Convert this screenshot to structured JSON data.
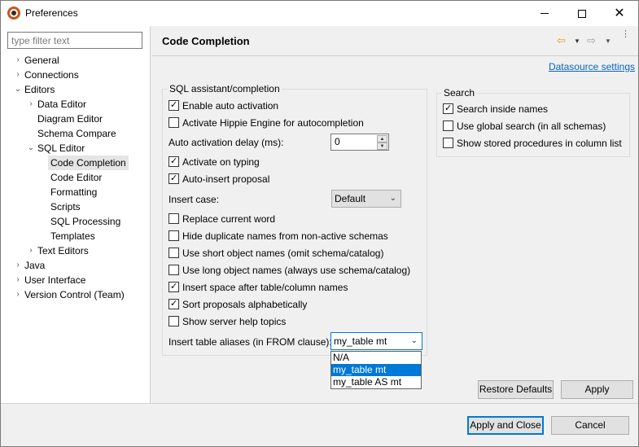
{
  "window": {
    "title": "Preferences",
    "minimize_glyph": "",
    "maximize_glyph": "",
    "close_glyph": "✕"
  },
  "filter": {
    "placeholder": "type filter text",
    "value": ""
  },
  "tree": {
    "chevron_collapsed": "›",
    "chevron_expanded": "⌄",
    "general": "General",
    "connections": "Connections",
    "editors": "Editors",
    "data_editor": "Data Editor",
    "diagram_editor": "Diagram Editor",
    "schema_compare": "Schema Compare",
    "sql_editor": "SQL Editor",
    "code_completion": "Code Completion",
    "code_editor": "Code Editor",
    "formatting": "Formatting",
    "scripts": "Scripts",
    "sql_processing": "SQL Processing",
    "templates": "Templates",
    "text_editors": "Text Editors",
    "java": "Java",
    "user_interface": "User Interface",
    "version_control": "Version Control (Team)"
  },
  "page": {
    "title": "Code Completion",
    "datasource_link": "Datasource settings",
    "nav_back_glyph": "⇦",
    "nav_fwd_glyph": "⇨",
    "nav_dd_glyph": "▼",
    "nav_menu_glyph": "⋮"
  },
  "sql_group": {
    "title": "SQL assistant/completion",
    "enable_auto_activation": "Enable auto activation",
    "activate_hippie": "Activate Hippie Engine for autocompletion",
    "auto_activation_delay_label": "Auto activation delay (ms):",
    "auto_activation_delay_value": "0",
    "activate_on_typing": "Activate on typing",
    "auto_insert_proposal": "Auto-insert proposal",
    "insert_case_label": "Insert case:",
    "insert_case_value": "Default",
    "replace_current_word": "Replace current word",
    "hide_duplicate": "Hide duplicate names from non-active schemas",
    "use_short_names": "Use short object names (omit schema/catalog)",
    "use_long_names": "Use long object names (always use schema/catalog)",
    "insert_space": "Insert space after table/column names",
    "sort_proposals": "Sort proposals alphabetically",
    "show_server_help": "Show server help topics",
    "table_aliases_label": "Insert table aliases (in FROM clause):",
    "table_aliases_value": "my_table mt",
    "table_aliases_options": [
      "N/A",
      "my_table mt",
      "my_table AS mt"
    ],
    "spin_up_glyph": "▲",
    "spin_down_glyph": "▼",
    "combo_arrow_glyph": "⌄"
  },
  "search_group": {
    "title": "Search",
    "search_inside_names": "Search inside names",
    "use_global_search": "Use global search (in all schemas)",
    "show_stored_procedures": "Show stored procedures in column list"
  },
  "buttons": {
    "restore_defaults": "Restore Defaults",
    "apply": "Apply",
    "apply_and_close": "Apply and Close",
    "cancel": "Cancel"
  },
  "colors": {
    "accent": "#0078d7",
    "link": "#0b64c2",
    "nav_back": "#e0a020"
  }
}
